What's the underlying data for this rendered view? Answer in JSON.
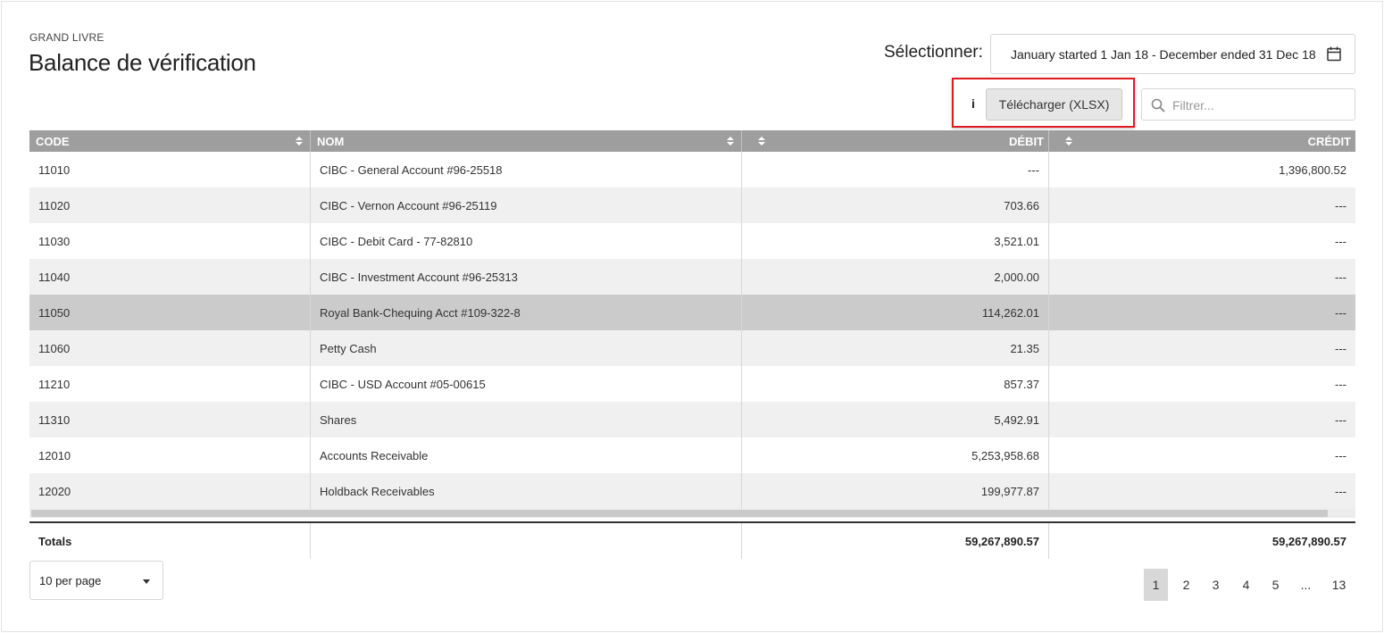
{
  "header": {
    "section": "GRAND LIVRE",
    "title": "Balance de vérification"
  },
  "period": {
    "label": "Sélectionner:",
    "value": "January started 1 Jan 18 - December ended 31 Dec 18",
    "icon": "calendar-icon"
  },
  "toolbar": {
    "info_label": "i",
    "download_label": "Télécharger (XLSX)",
    "highlight_color": "#e11b22",
    "filter_placeholder": "Filtrer...",
    "filter_icon": "search-icon"
  },
  "table": {
    "columns": [
      {
        "label": "CODE"
      },
      {
        "label": "NOM"
      },
      {
        "label": "DÉBIT"
      },
      {
        "label": "CRÉDIT"
      }
    ],
    "header_color": "#9e9e9e",
    "selected_row": 4,
    "rows": [
      {
        "code": "11010",
        "name": "CIBC - General Account #96-25518",
        "debit": "---",
        "credit": "1,396,800.52"
      },
      {
        "code": "11020",
        "name": "CIBC - Vernon Account #96-25119",
        "debit": "703.66",
        "credit": "---"
      },
      {
        "code": "11030",
        "name": "CIBC - Debit Card - 77-82810",
        "debit": "3,521.01",
        "credit": "---"
      },
      {
        "code": "11040",
        "name": "CIBC - Investment Account #96-25313",
        "debit": "2,000.00",
        "credit": "---"
      },
      {
        "code": "11050",
        "name": "Royal Bank-Chequing Acct #109-322-8",
        "debit": "114,262.01",
        "credit": "---"
      },
      {
        "code": "11060",
        "name": "Petty Cash",
        "debit": "21.35",
        "credit": "---"
      },
      {
        "code": "11210",
        "name": "CIBC - USD Account #05-00615",
        "debit": "857.37",
        "credit": "---"
      },
      {
        "code": "11310",
        "name": "Shares",
        "debit": "5,492.91",
        "credit": "---"
      },
      {
        "code": "12010",
        "name": "Accounts Receivable",
        "debit": "5,253,958.68",
        "credit": "---"
      },
      {
        "code": "12020",
        "name": "Holdback Receivables",
        "debit": "199,977.87",
        "credit": "---"
      }
    ],
    "totals": {
      "label": "Totals",
      "debit": "59,267,890.57",
      "credit": "59,267,890.57"
    }
  },
  "footer": {
    "per_page": "10 per page",
    "pages": [
      "1",
      "2",
      "3",
      "4",
      "5",
      "...",
      "13"
    ],
    "active_page": "1"
  }
}
